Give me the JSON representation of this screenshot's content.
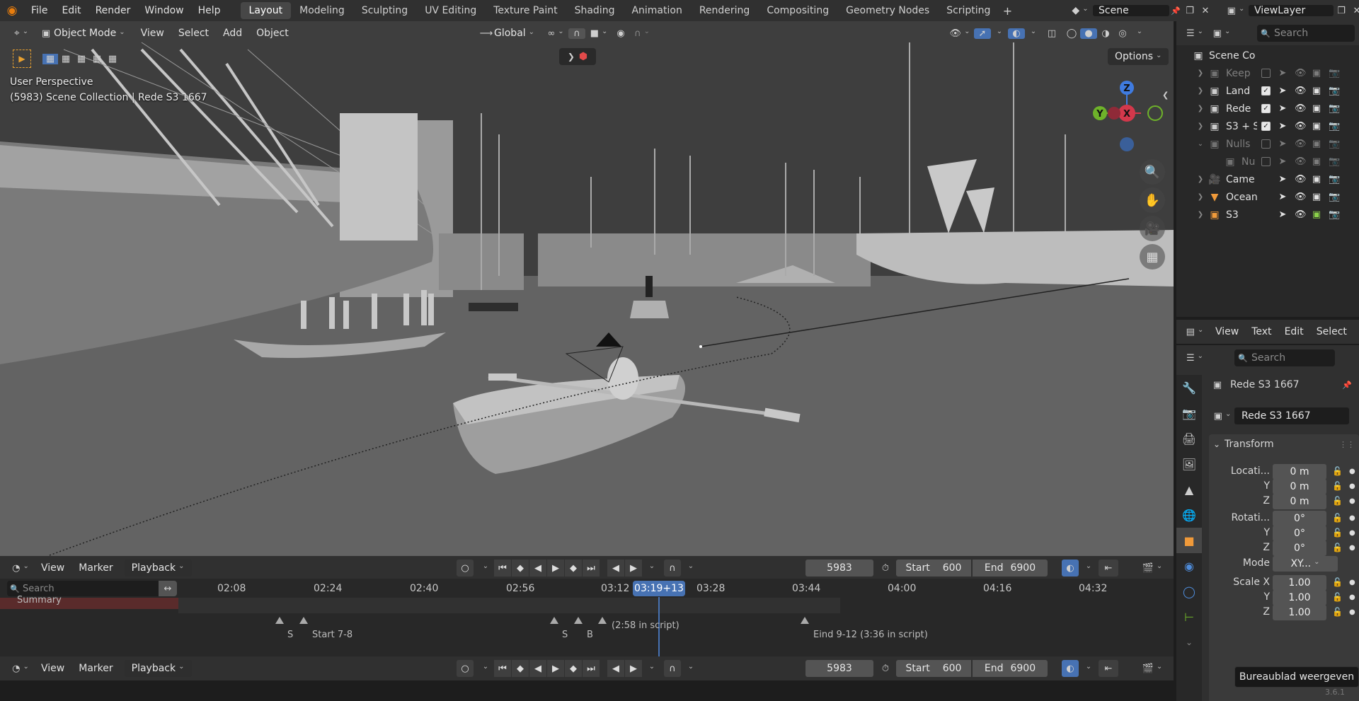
{
  "topbar": {
    "menus": [
      "File",
      "Edit",
      "Render",
      "Window",
      "Help"
    ],
    "workspaces": [
      "Layout",
      "Modeling",
      "Sculpting",
      "UV Editing",
      "Texture Paint",
      "Shading",
      "Animation",
      "Rendering",
      "Compositing",
      "Geometry Nodes",
      "Scripting"
    ],
    "active_workspace": "Layout",
    "scene": "Scene",
    "view_layer": "ViewLayer"
  },
  "viewport_header": {
    "mode": "Object Mode",
    "menus": [
      "View",
      "Select",
      "Add",
      "Object"
    ],
    "transform_orientation": "Global",
    "options_label": "Options"
  },
  "viewport": {
    "perspective": "User Perspective",
    "collection_info": "(5983) Scene Collection | Rede S3 1667",
    "gizmo": {
      "x": "X",
      "y": "Y",
      "z": "Z"
    }
  },
  "timeline": {
    "menus": [
      "View",
      "Marker",
      "Playback"
    ],
    "current_frame": "5983",
    "start_label": "Start",
    "start": "600",
    "end_label": "End",
    "end": "6900",
    "search_placeholder": "Search",
    "summary_label": "Summary",
    "playhead": "03:19+13",
    "ticks": [
      "02:08",
      "02:24",
      "02:40",
      "02:56",
      "03:12",
      "03:28",
      "03:44",
      "04:00",
      "04:16",
      "04:32"
    ],
    "markers": [
      "S",
      "Start 7-8",
      "S",
      "B",
      "(2:58 in script)",
      "Eind 9-12 (3:36 in script)"
    ]
  },
  "outliner": {
    "search_placeholder": "Search",
    "root": "Scene Co",
    "rows": [
      {
        "name": "Keep",
        "checked": false,
        "dim": true
      },
      {
        "name": "Land",
        "checked": true,
        "dim": false
      },
      {
        "name": "Rede",
        "checked": true,
        "dim": false
      },
      {
        "name": "S3 + S",
        "checked": true,
        "dim": false
      },
      {
        "name": "Nulls",
        "checked": false,
        "dim": true
      },
      {
        "name": "Nu",
        "checked": false,
        "dim": true
      },
      {
        "name": "Came",
        "checked": false,
        "dim": false
      },
      {
        "name": "Ocean",
        "checked": false,
        "dim": false
      },
      {
        "name": "S3",
        "checked": false,
        "dim": false
      }
    ]
  },
  "text_editor": {
    "menus": [
      "View",
      "Text",
      "Edit",
      "Select"
    ]
  },
  "properties": {
    "search_placeholder": "Search",
    "object_name": "Rede S3 1667",
    "object_field": "Rede S3 1667",
    "panel": "Transform",
    "location_label": "Locati...",
    "location": [
      "0 m",
      "0 m",
      "0 m"
    ],
    "rotation_label": "Rotati...",
    "rotation": [
      "0°",
      "0°",
      "0°"
    ],
    "mode_label": "Mode",
    "mode_value": "XY...",
    "scale_label": "Scale X",
    "scale": [
      "1.00",
      "1.00",
      "1.00"
    ],
    "axis_labels": [
      "Y",
      "Z"
    ]
  },
  "tooltip": "Bureaublad weergeven",
  "version": "3.6.1"
}
